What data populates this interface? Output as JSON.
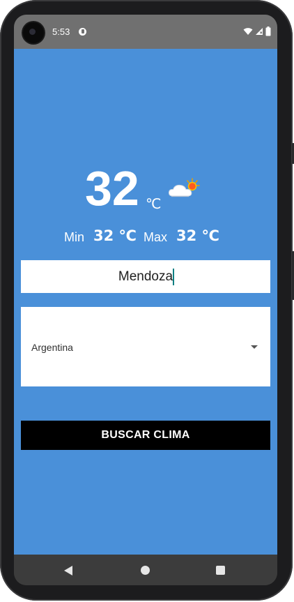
{
  "status_bar": {
    "time": "5:53",
    "icons": [
      "app-notification-icon",
      "wifi-icon",
      "signal-icon",
      "battery-icon"
    ]
  },
  "weather": {
    "temperature": "32",
    "unit": "℃",
    "icon": "partly-cloudy-sun-icon",
    "min_label": "Min",
    "min_value": "32 ℃",
    "max_label": "Max",
    "max_value": "32 ℃"
  },
  "city_input": {
    "value": "Mendoza"
  },
  "country_select": {
    "selected": "Argentina"
  },
  "search_button": {
    "label": "BUSCAR CLIMA"
  },
  "nav_bar": {
    "icons": [
      "back-icon",
      "home-icon",
      "recents-icon"
    ]
  },
  "colors": {
    "background": "#4a90d9",
    "status_bar": "#707070",
    "button": "#000000",
    "caret": "#0b7f82"
  }
}
